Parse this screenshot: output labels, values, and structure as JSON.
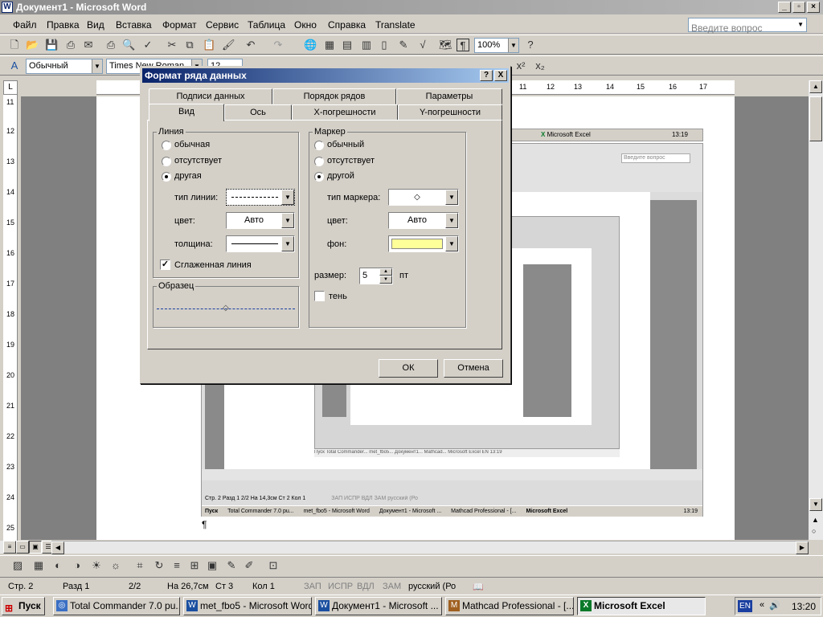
{
  "window": {
    "title": "Документ1 - Microsoft Word"
  },
  "menu": {
    "items": [
      "Файл",
      "Правка",
      "Вид",
      "Вставка",
      "Формат",
      "Сервис",
      "Таблица",
      "Окно",
      "Справка",
      "Translate"
    ],
    "ask_placeholder": "Введите вопрос"
  },
  "toolbar": {
    "zoom": "100%",
    "style": "Обычный",
    "font": "Times New Roman",
    "size": "12"
  },
  "ruler": {
    "h_numbers": [
      "11",
      "12",
      "13",
      "14",
      "15",
      "16",
      "17"
    ],
    "v_numbers": [
      "11",
      "12",
      "13",
      "14",
      "15",
      "16",
      "17",
      "18",
      "19",
      "20",
      "21",
      "22",
      "23",
      "24",
      "25"
    ]
  },
  "dialog": {
    "title": "Формат ряда данных",
    "help": "?",
    "close": "X",
    "tabs_back": [
      "Подписи данных",
      "Порядок рядов",
      "Параметры"
    ],
    "tabs_front": [
      "Вид",
      "Ось",
      "X-погрешности",
      "Y-погрешности"
    ],
    "line": {
      "group": "Линия",
      "options": [
        "обычная",
        "отсутствует",
        "другая"
      ],
      "selected": "другая",
      "type_label": "тип линии:",
      "color_label": "цвет:",
      "color_value": "Авто",
      "weight_label": "толщина:",
      "smoothed_label": "Сглаженная линия",
      "smoothed": true
    },
    "marker": {
      "group": "Маркер",
      "options": [
        "обычный",
        "отсутствует",
        "другой"
      ],
      "selected": "другой",
      "type_label": "тип маркера:",
      "color_label": "цвет:",
      "color_value": "Авто",
      "bg_label": "фон:",
      "bg_color": "#ffff99",
      "size_label": "размер:",
      "size_value": "5",
      "size_unit": "пт",
      "shadow_label": "тень"
    },
    "sample_group": "Образец",
    "ok": "ОК",
    "cancel": "Отмена"
  },
  "statusbar": {
    "page": "Стр. 2",
    "section": "Разд 1",
    "pages": "2/2",
    "pos": "На 26,7см",
    "line": "Ст 3",
    "col": "Кол 1",
    "rec": "ЗАП",
    "trk": "ИСПР",
    "ext": "ВДЛ",
    "ovr": "ЗАМ",
    "lang": "русский (Ро"
  },
  "taskbar": {
    "start": "Пуск",
    "tasks": [
      "Total Commander 7.0 pu...",
      "met_fbo5 - Microsoft Word",
      "Документ1 - Microsoft ...",
      "Mathcad Professional - [...",
      "Microsoft Excel"
    ],
    "lang": "EN",
    "clock": "13:20"
  },
  "embedded": {
    "excel_label": "Microsoft Excel",
    "clock": "13:19",
    "ask": "Введите вопрос",
    "status": "Стр. 2    Разд 1    2/2    На 14,3см  Ст 2    Кол 1",
    "status_right": "ЗАП  ИСПР  ВДЛ  ЗАМ  русский (Ро",
    "tasks": [
      "Total Commander 7.0 pu...",
      "met_fbo5 - Microsoft Word",
      "Документ1 - Microsoft ...",
      "Mathcad Professional - [...",
      "Microsoft Excel"
    ]
  }
}
